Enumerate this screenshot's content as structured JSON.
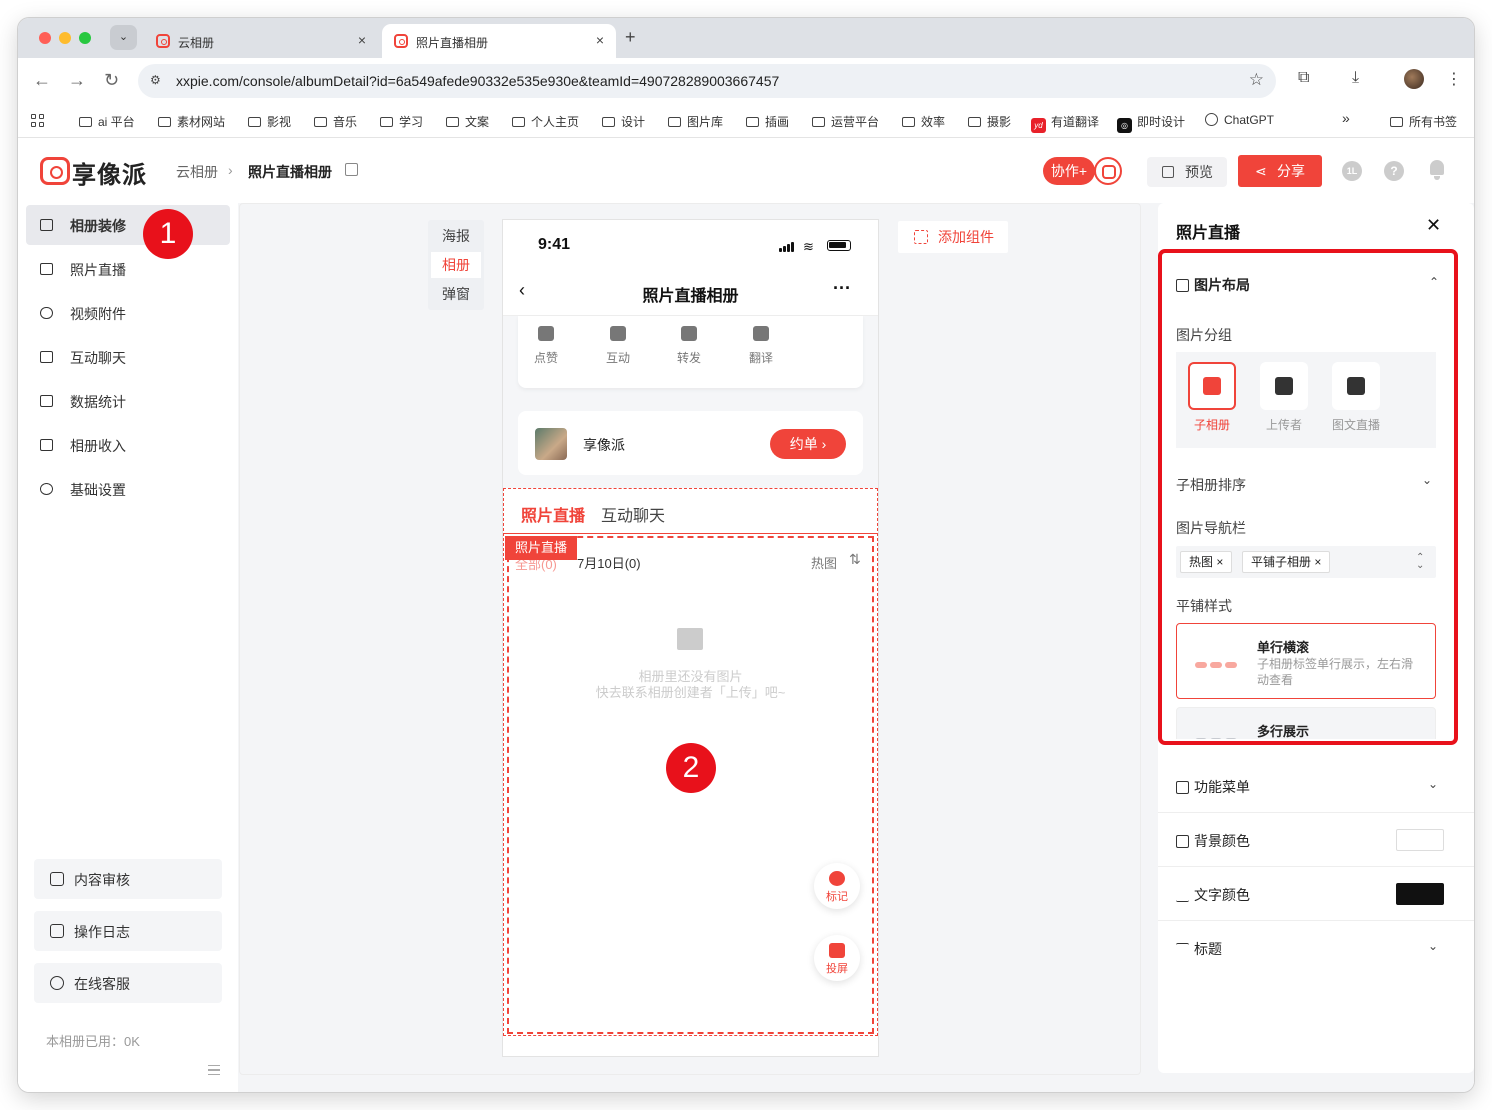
{
  "browser": {
    "tabs": [
      {
        "title": "云相册",
        "close": "×"
      },
      {
        "title": "照片直播相册",
        "close": "×"
      }
    ],
    "new_tab": "+",
    "url": "xxpie.com/console/albumDetail?id=6a549afede90332e535e930e&teamId=490728289003667457",
    "bookmarks": [
      "ai 平台",
      "素材网站",
      "影视",
      "音乐",
      "学习",
      "文案",
      "个人主页",
      "设计",
      "图片库",
      "插画",
      "运营平台",
      "效率",
      "摄影",
      "有道翻译",
      "即时设计",
      "ChatGPT",
      "所有书签"
    ],
    "bookmarks_more": "»",
    "bookmark_icon_text": {
      "youdao": "yd",
      "jishi": "◎"
    }
  },
  "header": {
    "logo_text": "享像派",
    "breadcrumb": [
      "云相册",
      "照片直播相册"
    ],
    "breadcrumb_sep": "›",
    "collab_label": "协作+",
    "preview_label": "预览",
    "share_label": "分享",
    "share_icon": "⋖",
    "avatar_initial": "1L",
    "help_glyph": "?"
  },
  "sidebar": {
    "items": [
      {
        "label": "相册装修",
        "icon": "decorate-icon",
        "selected": true
      },
      {
        "label": "照片直播",
        "icon": "photo-icon"
      },
      {
        "label": "视频附件",
        "icon": "attachment-icon"
      },
      {
        "label": "互动聊天",
        "icon": "chat-icon"
      },
      {
        "label": "数据统计",
        "icon": "stats-icon"
      },
      {
        "label": "相册收入",
        "icon": "income-icon"
      },
      {
        "label": "基础设置",
        "icon": "settings-icon"
      }
    ],
    "bottom_buttons": [
      {
        "label": "内容审核",
        "icon": "review-icon"
      },
      {
        "label": "操作日志",
        "icon": "log-icon"
      },
      {
        "label": "在线客服",
        "icon": "headset-icon"
      }
    ],
    "usage": "本相册已用：0K"
  },
  "editor": {
    "page_tabs": [
      "海报",
      "相册",
      "弹窗"
    ],
    "page_tab_selected": 1,
    "add_component": "添加组件",
    "phone": {
      "time": "9:41",
      "title": "照片直播相册",
      "back": "‹",
      "more": "···",
      "wifi": "≋",
      "actions": [
        "点赞",
        "互动",
        "转发",
        "翻译"
      ],
      "org_name": "享像派",
      "book_button": "约单  ›",
      "live_tabs": [
        "照片直播",
        "互动聊天"
      ],
      "component_label": "照片直播",
      "sub_tabs": {
        "all": "全部(0)",
        "date": "7月10日(0)",
        "hot": "热图",
        "sort": "⇅"
      },
      "empty_line1": "相册里还没有图片",
      "empty_line2": "快去联系相册创建者「上传」吧~",
      "float_buttons": [
        "标记",
        "投屏"
      ]
    }
  },
  "annotations": [
    "1",
    "2"
  ],
  "right_panel": {
    "title": "照片直播",
    "close": "✕",
    "layout_section": {
      "title": "图片布局",
      "group_label": "图片分组",
      "group_options": [
        "子相册",
        "上传者",
        "图文直播"
      ],
      "group_selected": 0,
      "sort_label": "子相册排序",
      "nav_label": "图片导航栏",
      "nav_tags": [
        "热图",
        "平铺子相册"
      ],
      "tag_remove": "×",
      "tile_label": "平铺样式",
      "tile_styles": [
        {
          "title": "单行横滚",
          "desc": "子相册标签单行展示，左右滑动查看"
        },
        {
          "title": "多行展示",
          "desc": ""
        }
      ]
    },
    "rows": [
      {
        "title": "功能菜单",
        "kind": "chevron"
      },
      {
        "title": "背景颜色",
        "kind": "swatch",
        "color": "#ffffff"
      },
      {
        "title": "文字颜色",
        "kind": "swatch",
        "color": "#111111"
      },
      {
        "title": "标题",
        "kind": "chevron"
      }
    ],
    "chevron_down": "⌄",
    "chevron_up": "⌃"
  },
  "colors": {
    "accent": "#f0443a",
    "annotation_red": "#e8111b"
  }
}
